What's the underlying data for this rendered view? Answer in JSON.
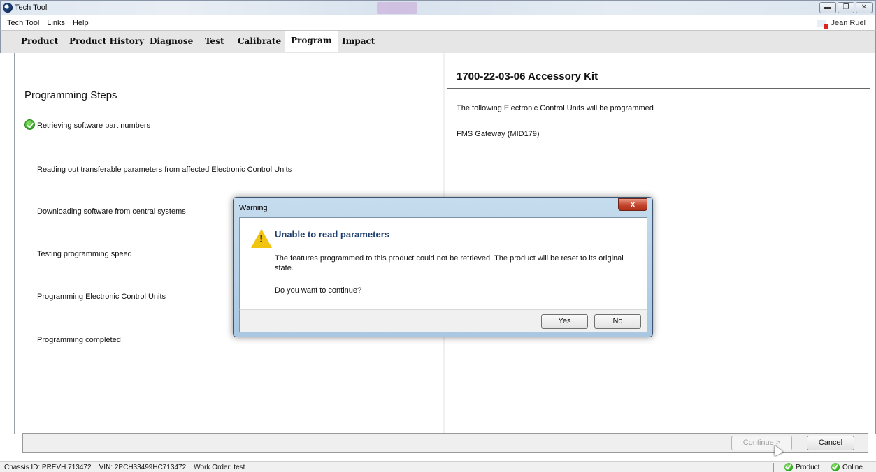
{
  "window": {
    "title": "Tech Tool"
  },
  "menu": {
    "items": [
      "Tech Tool",
      "Links",
      "Help"
    ],
    "user": "Jean Ruel"
  },
  "tabs": [
    "Product",
    "Product History",
    "Diagnose",
    "Test",
    "Calibrate",
    "Program",
    "Impact"
  ],
  "active_tab": "Program",
  "left_panel": {
    "title": "Programming Steps",
    "steps": [
      {
        "label": "Retrieving software part numbers",
        "status": "done"
      },
      {
        "label": "Reading out transferable parameters from affected Electronic Control Units",
        "status": "pending"
      },
      {
        "label": "Downloading software from central systems",
        "status": "pending"
      },
      {
        "label": "Testing programming speed",
        "status": "pending"
      },
      {
        "label": "Programming Electronic Control Units",
        "status": "pending"
      },
      {
        "label": "Programming completed",
        "status": "pending"
      }
    ]
  },
  "right_panel": {
    "title": "1700-22-03-06 Accessory Kit",
    "intro": "The following Electronic Control Units will be programmed",
    "ecu": "FMS Gateway (MID179)"
  },
  "footer_buttons": {
    "continue": "Continue >",
    "cancel": "Cancel"
  },
  "status": {
    "chassis": "Chassis ID: PREVH 713472",
    "vin": "VIN: 2PCH33499HC713472",
    "work_order": "Work Order: test",
    "product": "Product",
    "online": "Online"
  },
  "dialog": {
    "title": "Warning",
    "heading": "Unable to read parameters",
    "message": "The features programmed to this product could not be retrieved. The product will be reset to its original state.",
    "question": "Do you want to continue?",
    "yes": "Yes",
    "no": "No",
    "close": "x"
  },
  "colors": {
    "accent": "#1d3d6e",
    "success": "#2ea520",
    "warning": "#f1c40f",
    "close": "#c4432b"
  }
}
